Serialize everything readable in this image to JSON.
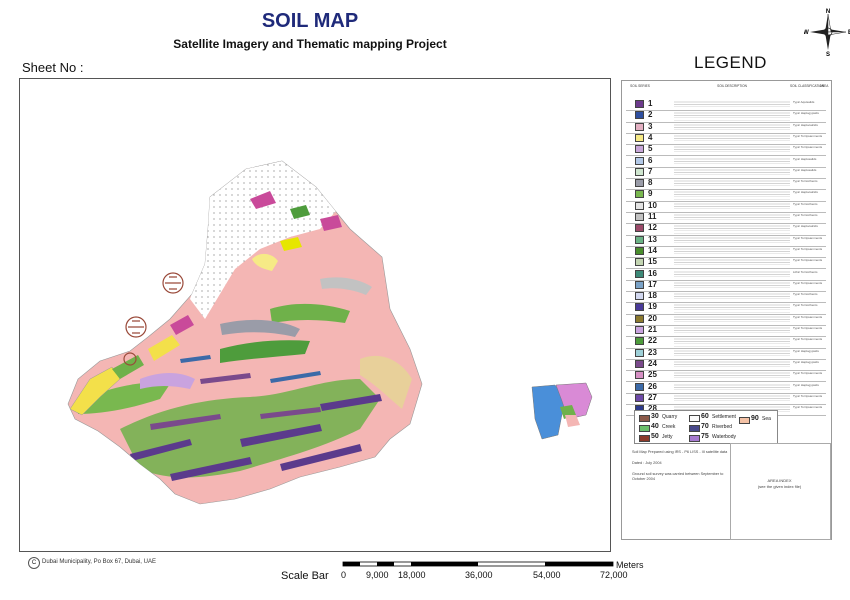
{
  "header": {
    "title": "SOIL MAP",
    "subtitle": "Satellite Imagery and Thematic mapping Project",
    "sheet_label": "Sheet No :"
  },
  "legend": {
    "title": "LEGEND",
    "column_headers": [
      "SOIL SERIES",
      "SOIL DESCRIPTION",
      "SOIL CLASSIFICATION",
      "AREA"
    ],
    "rows": [
      {
        "num": "1",
        "color": "#6c3a8c",
        "class": "Typic Aquisalids"
      },
      {
        "num": "2",
        "color": "#2e4fa0",
        "class": "Typic Haplogypsids"
      },
      {
        "num": "3",
        "color": "#e3b0c2",
        "class": "Typic Haplocalcids"
      },
      {
        "num": "4",
        "color": "#f6ea86",
        "class": "Typic Torripsamments"
      },
      {
        "num": "5",
        "color": "#c7a6d8",
        "class": "Typic Torripsamments"
      },
      {
        "num": "6",
        "color": "#b3c9e8",
        "class": "Typic Haplosalids"
      },
      {
        "num": "7",
        "color": "#cfe6cf",
        "class": "Typic Haplosalids"
      },
      {
        "num": "8",
        "color": "#9a9ca8",
        "class": "Typic Torriorthents"
      },
      {
        "num": "9",
        "color": "#79b84f",
        "class": "Typic Haplocalcids"
      },
      {
        "num": "10",
        "color": "#e3e3e3",
        "class": "Typic Torriorthents"
      },
      {
        "num": "11",
        "color": "#c2c2c2",
        "class": "Typic Torriorthents"
      },
      {
        "num": "12",
        "color": "#9c4a6a",
        "class": "Typic Haplocalcids"
      },
      {
        "num": "13",
        "color": "#6bb386",
        "class": "Typic Torripsamments"
      },
      {
        "num": "14",
        "color": "#4a8e2d",
        "class": "Typic Torripsamments"
      },
      {
        "num": "15",
        "color": "#c3d5b2",
        "class": "Typic Torripsamments"
      },
      {
        "num": "16",
        "color": "#3d8a78",
        "class": "Lithic Torriorthents"
      },
      {
        "num": "17",
        "color": "#7aa2c7",
        "class": "Typic Torripsamments"
      },
      {
        "num": "18",
        "color": "#d2d8f0",
        "class": "Typic Torriorthents"
      },
      {
        "num": "19",
        "color": "#4a3a9a",
        "class": "Typic Torriorthents"
      },
      {
        "num": "20",
        "color": "#8c7a2e",
        "class": "Typic Torripsamments"
      },
      {
        "num": "21",
        "color": "#c9a3df",
        "class": "Typic Torripsamments"
      },
      {
        "num": "22",
        "color": "#4e9c3c",
        "class": "Typic Torripsamments"
      },
      {
        "num": "23",
        "color": "#9ed0d8",
        "class": "Typic Haplogypsids"
      },
      {
        "num": "24",
        "color": "#7a4a8c",
        "class": "Typic Haplogypsids"
      },
      {
        "num": "25",
        "color": "#d690c4",
        "class": "Typic Torripsamments"
      },
      {
        "num": "26",
        "color": "#3c6aa8",
        "class": "Typic Haplogypsids"
      },
      {
        "num": "27",
        "color": "#6e4aa8",
        "class": "Typic Torripsamments"
      },
      {
        "num": "28",
        "color": "#2c3a8c",
        "class": "Typic Torripsamments"
      }
    ],
    "misc_units": [
      {
        "num": "30",
        "label": "Quarry",
        "color": "#8c5a4a"
      },
      {
        "num": "40",
        "label": "Creek",
        "color": "#6bbf6b"
      },
      {
        "num": "50",
        "label": "Jetty",
        "color": "#8c3a2a"
      },
      {
        "num": "60",
        "label": "Settlement",
        "color": "#fafafa"
      },
      {
        "num": "70",
        "label": "Riverbed",
        "color": "#4a4a8c"
      },
      {
        "num": "75",
        "label": "Waterbody",
        "color": "#a77ad0"
      },
      {
        "num": "90",
        "label": "Sea",
        "color": "#f4c2a6"
      }
    ],
    "note": [
      "Soil Map Prepared using IRS - P6 LISS - III satellite data",
      "Dated : July 2004",
      "Ground soil survey was carried between September to October 2004"
    ],
    "index_title": "AREA INDEX",
    "index_sub": "(see the given index file)"
  },
  "footer": {
    "copyright_symbol": "C",
    "credit": "Dubai Municipality, Po Box 67, Dubai, UAE"
  },
  "scale": {
    "label": "Scale Bar",
    "ticks": [
      "0",
      "9,000",
      "18,000",
      "36,000",
      "54,000",
      "72,000"
    ],
    "unit": "Meters"
  },
  "compass": {
    "n": "N",
    "s": "S",
    "e": "E",
    "w": "W"
  },
  "colors": {
    "base_pink": "#f4b6b4",
    "sea": "#ffffff",
    "settlement": "#fafafa",
    "green": "#6fb14a",
    "purple": "#5b3a8c"
  }
}
